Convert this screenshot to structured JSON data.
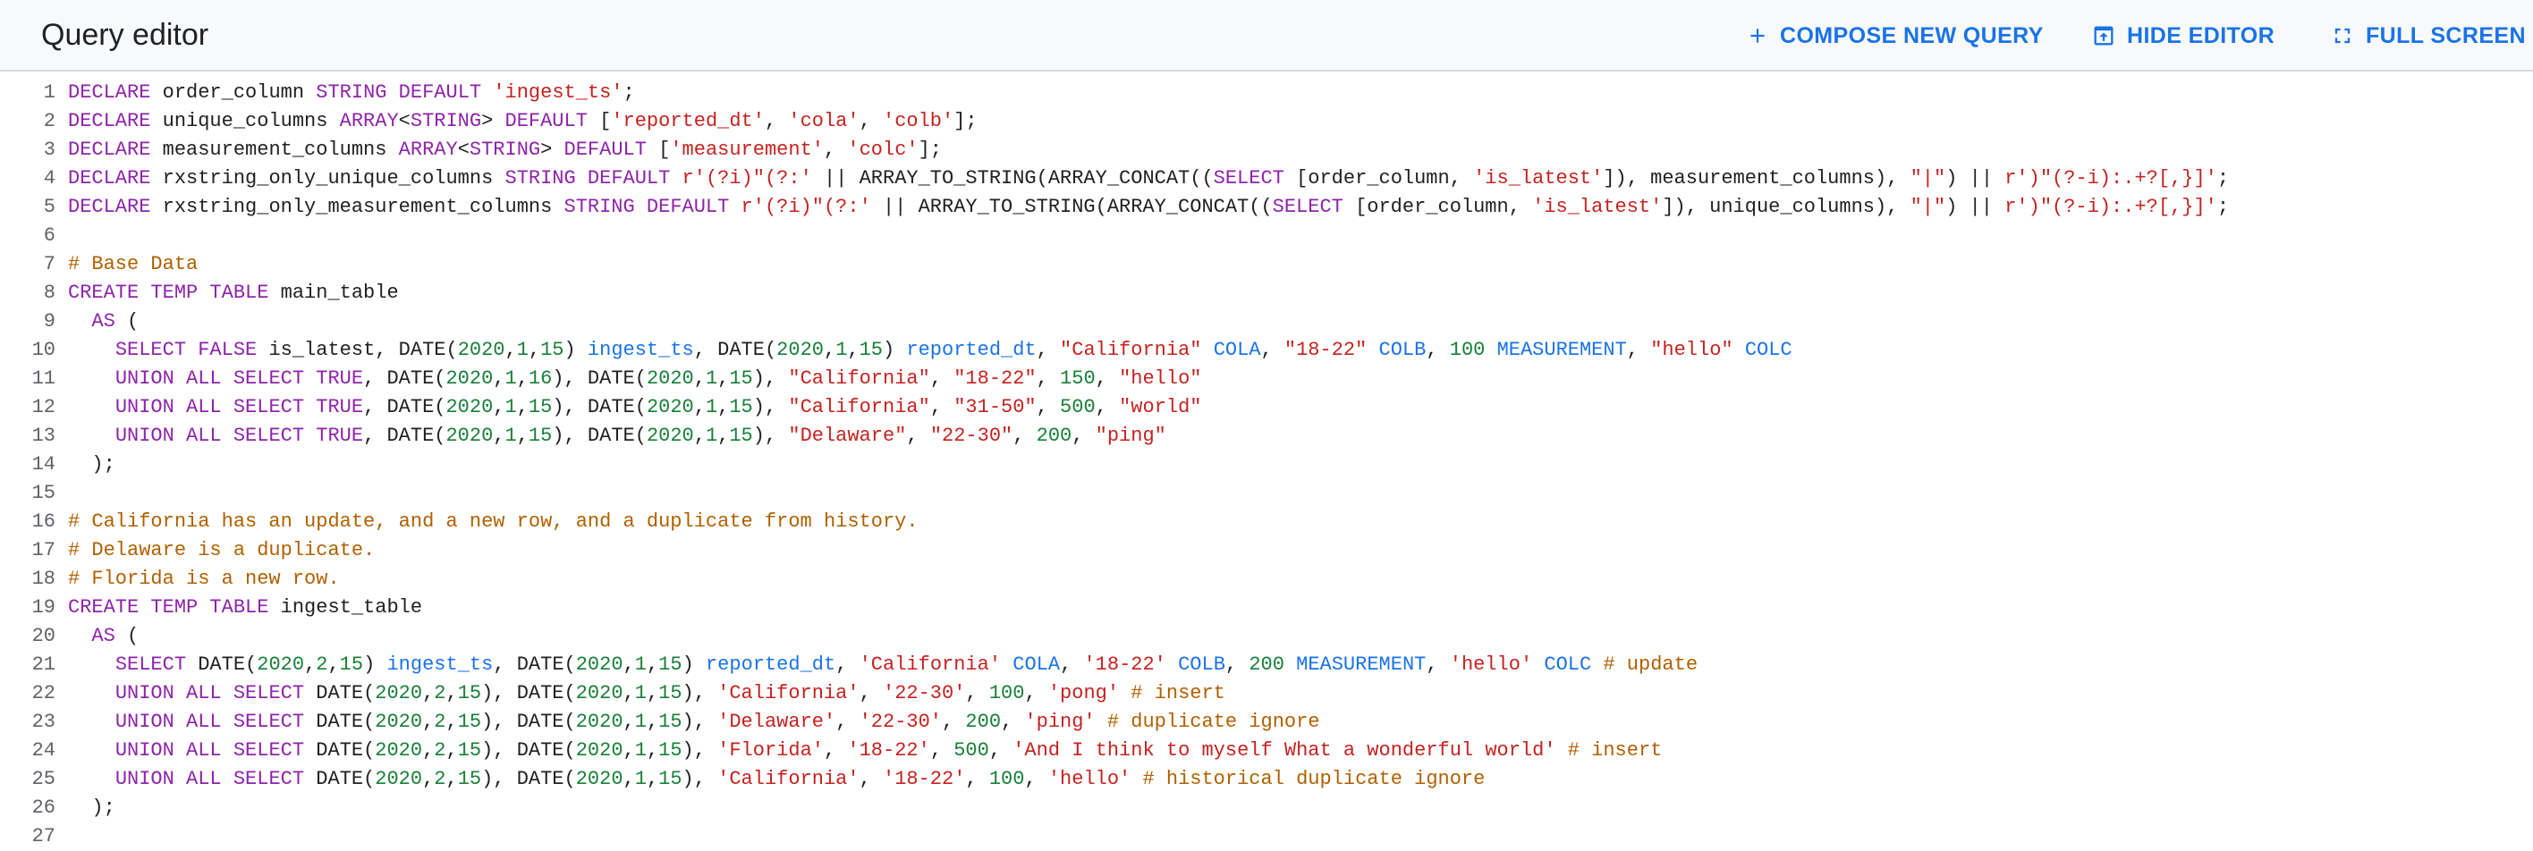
{
  "header": {
    "title": "Query editor",
    "compose_label": "COMPOSE NEW QUERY",
    "hide_label": "HIDE EDITOR",
    "full_label": "FULL SCREEN",
    "accent_color": "#1a73e8",
    "icons": {
      "compose": "plus-icon",
      "hide": "hide-editor-icon",
      "full": "fullscreen-icon"
    }
  },
  "editor": {
    "line_numbers": [
      "1",
      "2",
      "3",
      "4",
      "5",
      "6",
      "7",
      "8",
      "9",
      "10",
      "11",
      "12",
      "13",
      "14",
      "15",
      "16",
      "17",
      "18",
      "19",
      "20",
      "21",
      "22",
      "23",
      "24",
      "25",
      "26",
      "27"
    ],
    "token_colors": {
      "keyword": "#8e24aa",
      "string": "#c5221f",
      "number": "#188038",
      "field": "#1a73e8",
      "comment": "#b06000",
      "plain": "#202124"
    },
    "lines": [
      [
        [
          "kw",
          "DECLARE"
        ],
        [
          "p",
          " order_column "
        ],
        [
          "kw",
          "STRING DEFAULT"
        ],
        [
          "p",
          " "
        ],
        [
          "str",
          "'ingest_ts'"
        ],
        [
          "p",
          ";"
        ]
      ],
      [
        [
          "kw",
          "DECLARE"
        ],
        [
          "p",
          " unique_columns "
        ],
        [
          "kw",
          "ARRAY"
        ],
        [
          "p",
          "<"
        ],
        [
          "kw",
          "STRING"
        ],
        [
          "p",
          "> "
        ],
        [
          "kw",
          "DEFAULT"
        ],
        [
          "p",
          " ["
        ],
        [
          "str",
          "'reported_dt'"
        ],
        [
          "p",
          ", "
        ],
        [
          "str",
          "'cola'"
        ],
        [
          "p",
          ", "
        ],
        [
          "str",
          "'colb'"
        ],
        [
          "p",
          "];"
        ]
      ],
      [
        [
          "kw",
          "DECLARE"
        ],
        [
          "p",
          " measurement_columns "
        ],
        [
          "kw",
          "ARRAY"
        ],
        [
          "p",
          "<"
        ],
        [
          "kw",
          "STRING"
        ],
        [
          "p",
          "> "
        ],
        [
          "kw",
          "DEFAULT"
        ],
        [
          "p",
          " ["
        ],
        [
          "str",
          "'measurement'"
        ],
        [
          "p",
          ", "
        ],
        [
          "str",
          "'colc'"
        ],
        [
          "p",
          "];"
        ]
      ],
      [
        [
          "kw",
          "DECLARE"
        ],
        [
          "p",
          " rxstring_only_unique_columns "
        ],
        [
          "kw",
          "STRING DEFAULT"
        ],
        [
          "p",
          " "
        ],
        [
          "str",
          "r'(?i)\"(?:'"
        ],
        [
          "p",
          " || ARRAY_TO_STRING(ARRAY_CONCAT(("
        ],
        [
          "kw",
          "SELECT"
        ],
        [
          "p",
          " [order_column, "
        ],
        [
          "str",
          "'is_latest'"
        ],
        [
          "p",
          "]), measurement_columns), "
        ],
        [
          "str",
          "\"|\""
        ],
        [
          "p",
          ") || "
        ],
        [
          "str",
          "r')\"(?-i):.+?[,}]'"
        ],
        [
          "p",
          ";"
        ]
      ],
      [
        [
          "kw",
          "DECLARE"
        ],
        [
          "p",
          " rxstring_only_measurement_columns "
        ],
        [
          "kw",
          "STRING DEFAULT"
        ],
        [
          "p",
          " "
        ],
        [
          "str",
          "r'(?i)\"(?:'"
        ],
        [
          "p",
          " || ARRAY_TO_STRING(ARRAY_CONCAT(("
        ],
        [
          "kw",
          "SELECT"
        ],
        [
          "p",
          " [order_column, "
        ],
        [
          "str",
          "'is_latest'"
        ],
        [
          "p",
          "]), unique_columns), "
        ],
        [
          "str",
          "\"|\""
        ],
        [
          "p",
          ") || "
        ],
        [
          "str",
          "r')\"(?-i):.+?[,}]'"
        ],
        [
          "p",
          ";"
        ]
      ],
      [],
      [
        [
          "cmt",
          "# Base Data"
        ]
      ],
      [
        [
          "kw",
          "CREATE TEMP TABLE"
        ],
        [
          "p",
          " main_table"
        ]
      ],
      [
        [
          "p",
          "  "
        ],
        [
          "kw",
          "AS"
        ],
        [
          "p",
          " ("
        ]
      ],
      [
        [
          "p",
          "    "
        ],
        [
          "kw",
          "SELECT FALSE"
        ],
        [
          "p",
          " is_latest, DATE("
        ],
        [
          "num",
          "2020"
        ],
        [
          "p",
          ","
        ],
        [
          "num",
          "1"
        ],
        [
          "p",
          ","
        ],
        [
          "num",
          "15"
        ],
        [
          "p",
          ") "
        ],
        [
          "fld",
          "ingest_ts"
        ],
        [
          "p",
          ", DATE("
        ],
        [
          "num",
          "2020"
        ],
        [
          "p",
          ","
        ],
        [
          "num",
          "1"
        ],
        [
          "p",
          ","
        ],
        [
          "num",
          "15"
        ],
        [
          "p",
          ") "
        ],
        [
          "fld",
          "reported_dt"
        ],
        [
          "p",
          ", "
        ],
        [
          "str",
          "\"California\""
        ],
        [
          "p",
          " "
        ],
        [
          "fld",
          "COLA"
        ],
        [
          "p",
          ", "
        ],
        [
          "str",
          "\"18-22\""
        ],
        [
          "p",
          " "
        ],
        [
          "fld",
          "COLB"
        ],
        [
          "p",
          ", "
        ],
        [
          "num",
          "100"
        ],
        [
          "p",
          " "
        ],
        [
          "fld",
          "MEASUREMENT"
        ],
        [
          "p",
          ", "
        ],
        [
          "str",
          "\"hello\""
        ],
        [
          "p",
          " "
        ],
        [
          "fld",
          "COLC"
        ]
      ],
      [
        [
          "p",
          "    "
        ],
        [
          "kw",
          "UNION ALL SELECT TRUE"
        ],
        [
          "p",
          ", DATE("
        ],
        [
          "num",
          "2020"
        ],
        [
          "p",
          ","
        ],
        [
          "num",
          "1"
        ],
        [
          "p",
          ","
        ],
        [
          "num",
          "16"
        ],
        [
          "p",
          "), DATE("
        ],
        [
          "num",
          "2020"
        ],
        [
          "p",
          ","
        ],
        [
          "num",
          "1"
        ],
        [
          "p",
          ","
        ],
        [
          "num",
          "15"
        ],
        [
          "p",
          "), "
        ],
        [
          "str",
          "\"California\""
        ],
        [
          "p",
          ", "
        ],
        [
          "str",
          "\"18-22\""
        ],
        [
          "p",
          ", "
        ],
        [
          "num",
          "150"
        ],
        [
          "p",
          ", "
        ],
        [
          "str",
          "\"hello\""
        ]
      ],
      [
        [
          "p",
          "    "
        ],
        [
          "kw",
          "UNION ALL SELECT TRUE"
        ],
        [
          "p",
          ", DATE("
        ],
        [
          "num",
          "2020"
        ],
        [
          "p",
          ","
        ],
        [
          "num",
          "1"
        ],
        [
          "p",
          ","
        ],
        [
          "num",
          "15"
        ],
        [
          "p",
          "), DATE("
        ],
        [
          "num",
          "2020"
        ],
        [
          "p",
          ","
        ],
        [
          "num",
          "1"
        ],
        [
          "p",
          ","
        ],
        [
          "num",
          "15"
        ],
        [
          "p",
          "), "
        ],
        [
          "str",
          "\"California\""
        ],
        [
          "p",
          ", "
        ],
        [
          "str",
          "\"31-50\""
        ],
        [
          "p",
          ", "
        ],
        [
          "num",
          "500"
        ],
        [
          "p",
          ", "
        ],
        [
          "str",
          "\"world\""
        ]
      ],
      [
        [
          "p",
          "    "
        ],
        [
          "kw",
          "UNION ALL SELECT TRUE"
        ],
        [
          "p",
          ", DATE("
        ],
        [
          "num",
          "2020"
        ],
        [
          "p",
          ","
        ],
        [
          "num",
          "1"
        ],
        [
          "p",
          ","
        ],
        [
          "num",
          "15"
        ],
        [
          "p",
          "), DATE("
        ],
        [
          "num",
          "2020"
        ],
        [
          "p",
          ","
        ],
        [
          "num",
          "1"
        ],
        [
          "p",
          ","
        ],
        [
          "num",
          "15"
        ],
        [
          "p",
          "), "
        ],
        [
          "str",
          "\"Delaware\""
        ],
        [
          "p",
          ", "
        ],
        [
          "str",
          "\"22-30\""
        ],
        [
          "p",
          ", "
        ],
        [
          "num",
          "200"
        ],
        [
          "p",
          ", "
        ],
        [
          "str",
          "\"ping\""
        ]
      ],
      [
        [
          "p",
          "  );"
        ]
      ],
      [],
      [
        [
          "cmt",
          "# California has an update, and a new row, and a duplicate from history."
        ]
      ],
      [
        [
          "cmt",
          "# Delaware is a duplicate."
        ]
      ],
      [
        [
          "cmt",
          "# Florida is a new row."
        ]
      ],
      [
        [
          "kw",
          "CREATE TEMP TABLE"
        ],
        [
          "p",
          " ingest_table"
        ]
      ],
      [
        [
          "p",
          "  "
        ],
        [
          "kw",
          "AS"
        ],
        [
          "p",
          " ("
        ]
      ],
      [
        [
          "p",
          "    "
        ],
        [
          "kw",
          "SELECT"
        ],
        [
          "p",
          " DATE("
        ],
        [
          "num",
          "2020"
        ],
        [
          "p",
          ","
        ],
        [
          "num",
          "2"
        ],
        [
          "p",
          ","
        ],
        [
          "num",
          "15"
        ],
        [
          "p",
          ") "
        ],
        [
          "fld",
          "ingest_ts"
        ],
        [
          "p",
          ", DATE("
        ],
        [
          "num",
          "2020"
        ],
        [
          "p",
          ","
        ],
        [
          "num",
          "1"
        ],
        [
          "p",
          ","
        ],
        [
          "num",
          "15"
        ],
        [
          "p",
          ") "
        ],
        [
          "fld",
          "reported_dt"
        ],
        [
          "p",
          ", "
        ],
        [
          "str",
          "'California'"
        ],
        [
          "p",
          " "
        ],
        [
          "fld",
          "COLA"
        ],
        [
          "p",
          ", "
        ],
        [
          "str",
          "'18-22'"
        ],
        [
          "p",
          " "
        ],
        [
          "fld",
          "COLB"
        ],
        [
          "p",
          ", "
        ],
        [
          "num",
          "200"
        ],
        [
          "p",
          " "
        ],
        [
          "fld",
          "MEASUREMENT"
        ],
        [
          "p",
          ", "
        ],
        [
          "str",
          "'hello'"
        ],
        [
          "p",
          " "
        ],
        [
          "fld",
          "COLC"
        ],
        [
          "p",
          " "
        ],
        [
          "cmt",
          "# update"
        ]
      ],
      [
        [
          "p",
          "    "
        ],
        [
          "kw",
          "UNION ALL SELECT"
        ],
        [
          "p",
          " DATE("
        ],
        [
          "num",
          "2020"
        ],
        [
          "p",
          ","
        ],
        [
          "num",
          "2"
        ],
        [
          "p",
          ","
        ],
        [
          "num",
          "15"
        ],
        [
          "p",
          "), DATE("
        ],
        [
          "num",
          "2020"
        ],
        [
          "p",
          ","
        ],
        [
          "num",
          "1"
        ],
        [
          "p",
          ","
        ],
        [
          "num",
          "15"
        ],
        [
          "p",
          "), "
        ],
        [
          "str",
          "'California'"
        ],
        [
          "p",
          ", "
        ],
        [
          "str",
          "'22-30'"
        ],
        [
          "p",
          ", "
        ],
        [
          "num",
          "100"
        ],
        [
          "p",
          ", "
        ],
        [
          "str",
          "'pong'"
        ],
        [
          "p",
          " "
        ],
        [
          "cmt",
          "# insert"
        ]
      ],
      [
        [
          "p",
          "    "
        ],
        [
          "kw",
          "UNION ALL SELECT"
        ],
        [
          "p",
          " DATE("
        ],
        [
          "num",
          "2020"
        ],
        [
          "p",
          ","
        ],
        [
          "num",
          "2"
        ],
        [
          "p",
          ","
        ],
        [
          "num",
          "15"
        ],
        [
          "p",
          "), DATE("
        ],
        [
          "num",
          "2020"
        ],
        [
          "p",
          ","
        ],
        [
          "num",
          "1"
        ],
        [
          "p",
          ","
        ],
        [
          "num",
          "15"
        ],
        [
          "p",
          "), "
        ],
        [
          "str",
          "'Delaware'"
        ],
        [
          "p",
          ", "
        ],
        [
          "str",
          "'22-30'"
        ],
        [
          "p",
          ", "
        ],
        [
          "num",
          "200"
        ],
        [
          "p",
          ", "
        ],
        [
          "str",
          "'ping'"
        ],
        [
          "p",
          " "
        ],
        [
          "cmt",
          "# duplicate ignore"
        ]
      ],
      [
        [
          "p",
          "    "
        ],
        [
          "kw",
          "UNION ALL SELECT"
        ],
        [
          "p",
          " DATE("
        ],
        [
          "num",
          "2020"
        ],
        [
          "p",
          ","
        ],
        [
          "num",
          "2"
        ],
        [
          "p",
          ","
        ],
        [
          "num",
          "15"
        ],
        [
          "p",
          "), DATE("
        ],
        [
          "num",
          "2020"
        ],
        [
          "p",
          ","
        ],
        [
          "num",
          "1"
        ],
        [
          "p",
          ","
        ],
        [
          "num",
          "15"
        ],
        [
          "p",
          "), "
        ],
        [
          "str",
          "'Florida'"
        ],
        [
          "p",
          ", "
        ],
        [
          "str",
          "'18-22'"
        ],
        [
          "p",
          ", "
        ],
        [
          "num",
          "500"
        ],
        [
          "p",
          ", "
        ],
        [
          "str",
          "'And I think to myself What a wonderful world'"
        ],
        [
          "p",
          " "
        ],
        [
          "cmt",
          "# insert"
        ]
      ],
      [
        [
          "p",
          "    "
        ],
        [
          "kw",
          "UNION ALL SELECT"
        ],
        [
          "p",
          " DATE("
        ],
        [
          "num",
          "2020"
        ],
        [
          "p",
          ","
        ],
        [
          "num",
          "2"
        ],
        [
          "p",
          ","
        ],
        [
          "num",
          "15"
        ],
        [
          "p",
          "), DATE("
        ],
        [
          "num",
          "2020"
        ],
        [
          "p",
          ","
        ],
        [
          "num",
          "1"
        ],
        [
          "p",
          ","
        ],
        [
          "num",
          "15"
        ],
        [
          "p",
          "), "
        ],
        [
          "str",
          "'California'"
        ],
        [
          "p",
          ", "
        ],
        [
          "str",
          "'18-22'"
        ],
        [
          "p",
          ", "
        ],
        [
          "num",
          "100"
        ],
        [
          "p",
          ", "
        ],
        [
          "str",
          "'hello'"
        ],
        [
          "p",
          " "
        ],
        [
          "cmt",
          "# historical duplicate ignore"
        ]
      ],
      [
        [
          "p",
          "  );"
        ]
      ],
      []
    ]
  }
}
